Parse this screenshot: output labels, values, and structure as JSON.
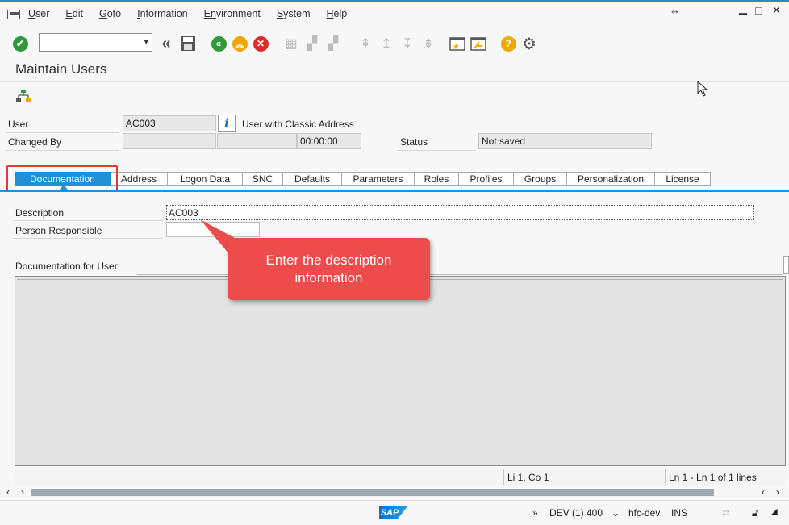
{
  "menu": {
    "items": [
      {
        "underline": "U",
        "rest": "ser"
      },
      {
        "underline": "E",
        "rest": "dit"
      },
      {
        "underline": "G",
        "rest": "oto"
      },
      {
        "underline": "I",
        "rest": "nformation"
      },
      {
        "underline": "En",
        "rest": "vironment"
      },
      {
        "underline": "S",
        "rest": "ystem"
      },
      {
        "underline": "H",
        "rest": "elp"
      }
    ],
    "resize_glyph": "↔",
    "minimize_glyph": "▁",
    "maximize_glyph": "□",
    "close_glyph": "✕"
  },
  "toolbar": {
    "command_field_value": "",
    "icons": [
      "enter-check",
      "command-field",
      "back-double",
      "save",
      "back",
      "exit",
      "cancel",
      "print",
      "find",
      "find-next",
      "first-page",
      "previous-page",
      "next-page",
      "last-page",
      "create-session",
      "generate-shortcut",
      "help",
      "customize-layout"
    ]
  },
  "title": "Maintain Users",
  "header": {
    "user_label": "User",
    "user_value": "AC003",
    "info_label": "i",
    "user_type_text": "User with Classic Address",
    "changed_by_label": "Changed By",
    "changed_by_value": "",
    "changed_date_value": "",
    "changed_time_value": "00:00:00",
    "status_label": "Status",
    "status_value": "Not saved"
  },
  "tabs": [
    {
      "label": "Documentation",
      "width": 0
    },
    {
      "label": "Address"
    },
    {
      "label": "Logon Data"
    },
    {
      "label": "SNC"
    },
    {
      "label": "Defaults"
    },
    {
      "label": "Parameters"
    },
    {
      "label": "Roles"
    },
    {
      "label": "Profiles"
    },
    {
      "label": "Groups"
    },
    {
      "label": "Personalization"
    },
    {
      "label": "License"
    }
  ],
  "documentation": {
    "description_label": "Description",
    "description_value": "AC003",
    "person_responsible_label": "Person Responsible",
    "person_responsible_value": "",
    "doc_for_user_label": "Documentation for User:"
  },
  "callout_text": "Enter the description information",
  "editor_status": {
    "position": "Li 1, Co 1",
    "lines": "Ln 1 - Ln 1 of 1 lines"
  },
  "footer": {
    "sap_logo": "SAP",
    "system": "DEV (1) 400",
    "server": "hfc-dev",
    "mode": "INS"
  },
  "colors": {
    "accent": "#1e90d8",
    "callout": "#ee4c4c",
    "highlight": "#e53935"
  }
}
